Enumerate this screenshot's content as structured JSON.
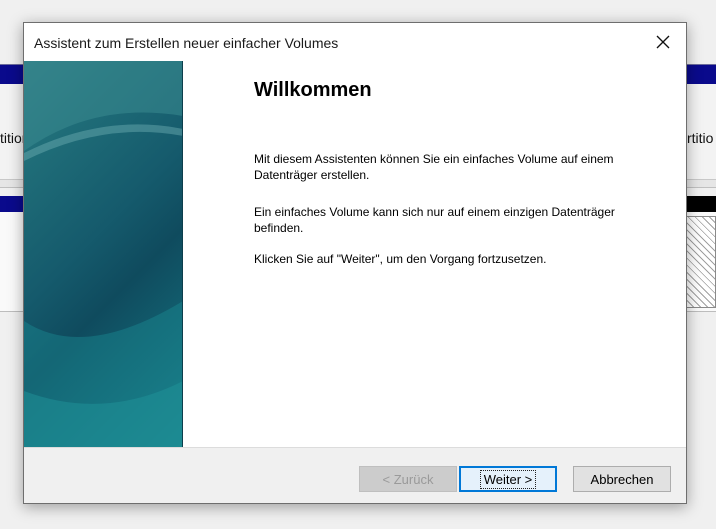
{
  "background": {
    "left_fragment": "tition",
    "right_fragment": "rtitio"
  },
  "dialog": {
    "title": "Assistent zum Erstellen neuer einfacher Volumes",
    "close_icon": "close-icon",
    "heading": "Willkommen",
    "paragraphs": [
      "Mit diesem Assistenten können Sie ein einfaches Volume auf einem Datenträger erstellen.",
      "Ein einfaches Volume kann sich nur auf einem einzigen Datenträger befinden.",
      "Klicken Sie auf \"Weiter\", um den Vorgang fortzusetzen."
    ],
    "buttons": {
      "back": "< Zurück",
      "next": "Weiter >",
      "cancel": "Abbrechen"
    }
  },
  "colors": {
    "banner_teal": "#1f6d78",
    "background_band_blue": "#0a0a8c",
    "default_button_border": "#0078d7"
  }
}
